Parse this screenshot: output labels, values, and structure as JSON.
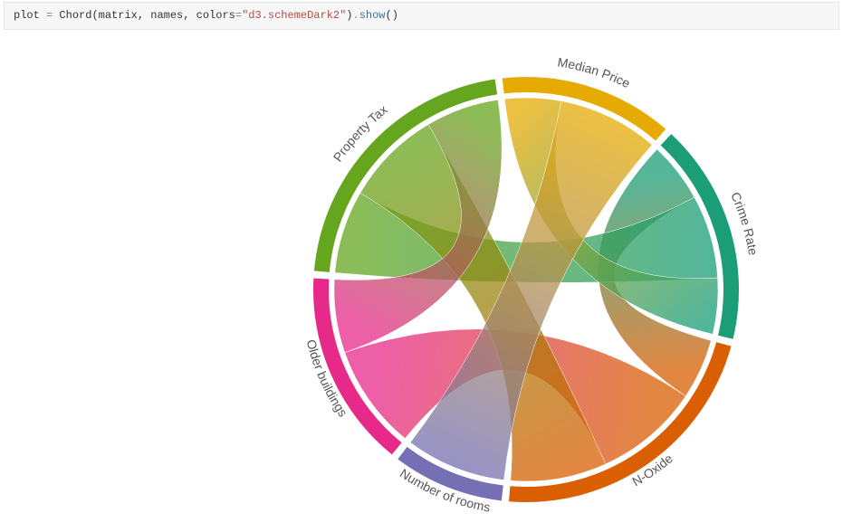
{
  "code": {
    "var": "plot",
    "eq": " = ",
    "cls": "Chord",
    "args_prefix": "(matrix, names, colors",
    "str_eq": "=",
    "str_val": "\"d3.schemeDark2\"",
    "close_paren": ")",
    "dot": ".",
    "method": "show",
    "tail": "()"
  },
  "chart_data": {
    "type": "chord",
    "categories": [
      "Crime Rate",
      "N-Oxide",
      "Number of rooms",
      "Older buildings",
      "Property Tax",
      "Median Price"
    ],
    "colors": [
      "#1b9e77",
      "#d95f02",
      "#7570b3",
      "#e7298a",
      "#66a61e",
      "#e6ab02"
    ],
    "matrix": [
      [
        0.0,
        0.42,
        0.0,
        0.0,
        0.58,
        0.39
      ],
      [
        0.42,
        0.0,
        0.0,
        0.73,
        0.67,
        0.0
      ],
      [
        0.0,
        0.0,
        0.0,
        0.0,
        0.0,
        0.7
      ],
      [
        0.0,
        0.73,
        0.0,
        0.0,
        0.51,
        0.0
      ],
      [
        0.58,
        0.67,
        0.0,
        0.51,
        0.0,
        0.0
      ],
      [
        0.39,
        0.0,
        0.7,
        0.0,
        0.0,
        0.0
      ]
    ],
    "ribbon_gradients": [
      {
        "source": 0,
        "target": 4,
        "value": 0.58
      },
      {
        "source": 0,
        "target": 1,
        "value": 0.42
      },
      {
        "source": 0,
        "target": 5,
        "value": 0.39
      },
      {
        "source": 1,
        "target": 3,
        "value": 0.73
      },
      {
        "source": 1,
        "target": 4,
        "value": 0.67
      },
      {
        "source": 2,
        "target": 5,
        "value": 0.7
      },
      {
        "source": 3,
        "target": 4,
        "value": 0.51
      }
    ],
    "pad_angle_deg": 2,
    "start_angle_deg": 43,
    "radius_outer": 235,
    "radius_inner": 218,
    "ribbon_radius": 212
  }
}
